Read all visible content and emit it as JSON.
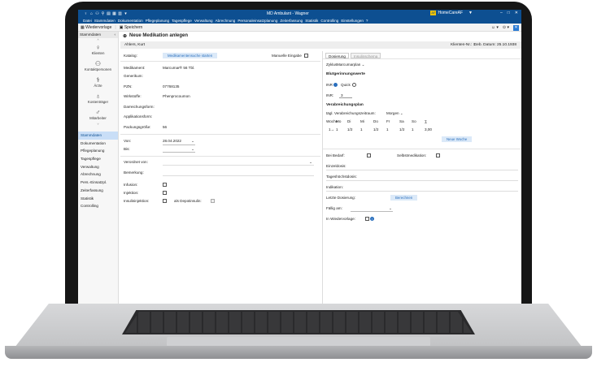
{
  "app": {
    "title": "MD Ambulant - Wagner",
    "brand": "HomeCareAF",
    "menu": [
      "Datei",
      "Stammdaten",
      "Dokumentation",
      "Pflegeplanung",
      "Tagespflege",
      "Verwaltung",
      "Abrechnung",
      "Personaleinsatzplanung",
      "Zeiterfassung",
      "Statistik",
      "Controlling",
      "Einstellungen",
      "?"
    ]
  },
  "toolbar": {
    "vorlage_label": "Wiedervorlage",
    "save_label": "Speichern"
  },
  "sidebar": {
    "header": "Stammdaten",
    "icon_items": [
      {
        "label": "Klienten"
      },
      {
        "label": "Kontaktpersonen"
      },
      {
        "label": "Ärzte"
      },
      {
        "label": "Kostenträger"
      },
      {
        "label": "Mitarbeiter"
      }
    ],
    "nav_items": [
      "Stammdaten",
      "Dokumentation",
      "Pflegeplanung",
      "Tagespflege",
      "Verwaltung",
      "Abrechnung",
      "Pers.-Einsatzpl.",
      "Zeiterfassung",
      "Statistik",
      "Controlling"
    ]
  },
  "main": {
    "title": "Neue Medikation anlegen",
    "patient": "Ahlers, Kurt",
    "client_nr": "Klienten-Nr.: 1",
    "birth": "Geb. Datum: 25.10.1938"
  },
  "left": {
    "katalog_label": "Katalog:",
    "search_button": "Medikamentensuche starten",
    "manual_label": "Manuelle Eingabe",
    "medikament_label": "Medikament:",
    "medikament_value": "Marcumar® 56 Tbl.",
    "generikum_label": "Generikum:",
    "pzn_label": "PZN:",
    "pzn_value": "07768135",
    "wirkstoffe_label": "Wirkstoffe:",
    "wirkstoffe_value": "Phenprocoumon",
    "darreichung_label": "Darreichungsform:",
    "applikation_label": "Applikationsform:",
    "packung_label": "Packungsgröße:",
    "packung_value": "56",
    "von_label": "Von:",
    "von_value": "28.04.2022",
    "bis_label": "Bis:",
    "verordnet_label": "Verordnet von:",
    "bemerkung_label": "Bemerkung:",
    "infusion_label": "Infusion:",
    "injektion_label": "Injektion:",
    "insulin_label": "Insulininjektion:",
    "depot_label": "als Depotinsulin:"
  },
  "right": {
    "tabs": [
      "Dosierung",
      "Insulinschema"
    ],
    "zyklus_label": "Zyklus",
    "zyklus_value": "Marcumarplan",
    "blut_title": "Blutgerinnungswerte",
    "inr_label": "INR",
    "quick_label": "Quick",
    "inr_field_label": "INR:",
    "inr_value": "3",
    "plan_title": "Verabreichungsplan",
    "zeitraum_label": "tägl. Verabreichungszeitraum:",
    "zeitraum_value": "Morgen",
    "week_headers": [
      "Woche",
      "Mo",
      "Di",
      "Mi",
      "Do",
      "Fr",
      "Sa",
      "So",
      "∑"
    ],
    "week_values": [
      "1→",
      "1",
      "1/2",
      "1",
      "1/2",
      "1",
      "1/2",
      "1",
      "3,00"
    ],
    "new_week_button": "Neue Woche",
    "bedarf_label": "Bei Bedarf:",
    "selbst_label": "Selbstmedikation:",
    "einzeldosis_label": "Einzeldosis:",
    "tages_label": "Tageshöchstdosis:",
    "indikation_label": "Indikation:",
    "letzte_label": "Letzte Dosierung:",
    "berechnen_button": "Berechnen",
    "faellig_label": "Fällig am:",
    "wiedervorlage_label": "In Wiedervorlage:"
  }
}
